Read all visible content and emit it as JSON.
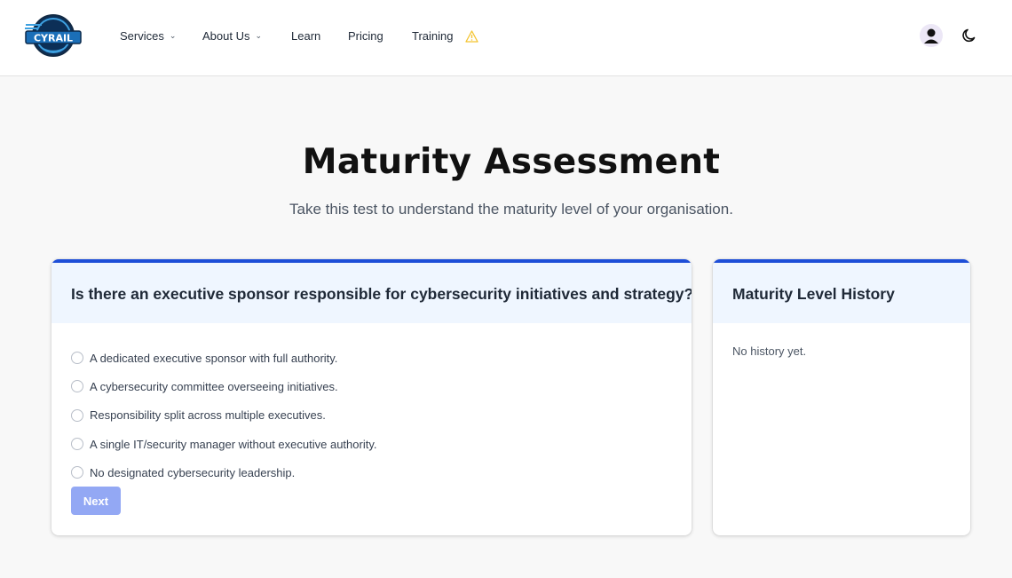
{
  "header": {
    "logo_text": "CYRAIL",
    "nav": [
      {
        "label": "Services",
        "dropdown": true
      },
      {
        "label": "About Us",
        "dropdown": true
      },
      {
        "label": "Learn",
        "dropdown": false
      },
      {
        "label": "Pricing",
        "dropdown": false
      },
      {
        "label": "Training",
        "dropdown": false,
        "badge_icon": "warning-icon"
      }
    ],
    "user_icon": "user-avatar-icon",
    "theme_icon": "moon-icon"
  },
  "page": {
    "title": "Maturity Assessment",
    "subtitle": "Take this test to understand the maturity level of your organisation."
  },
  "question_card": {
    "question": "Is there an executive sponsor responsible for cybersecurity initiatives and strategy?",
    "options": [
      "A dedicated executive sponsor with full authority.",
      "A cybersecurity committee overseeing initiatives.",
      "Responsibility split across multiple executives.",
      "A single IT/security manager without executive authority.",
      "No designated cybersecurity leadership."
    ],
    "next_label": "Next"
  },
  "history_card": {
    "title": "Maturity Level History",
    "empty_text": "No history yet."
  },
  "colors": {
    "accent": "#1d4ed8",
    "card_header_bg": "#eff6ff",
    "button_disabled": "#93a8f4",
    "warning": "#f4c430"
  }
}
